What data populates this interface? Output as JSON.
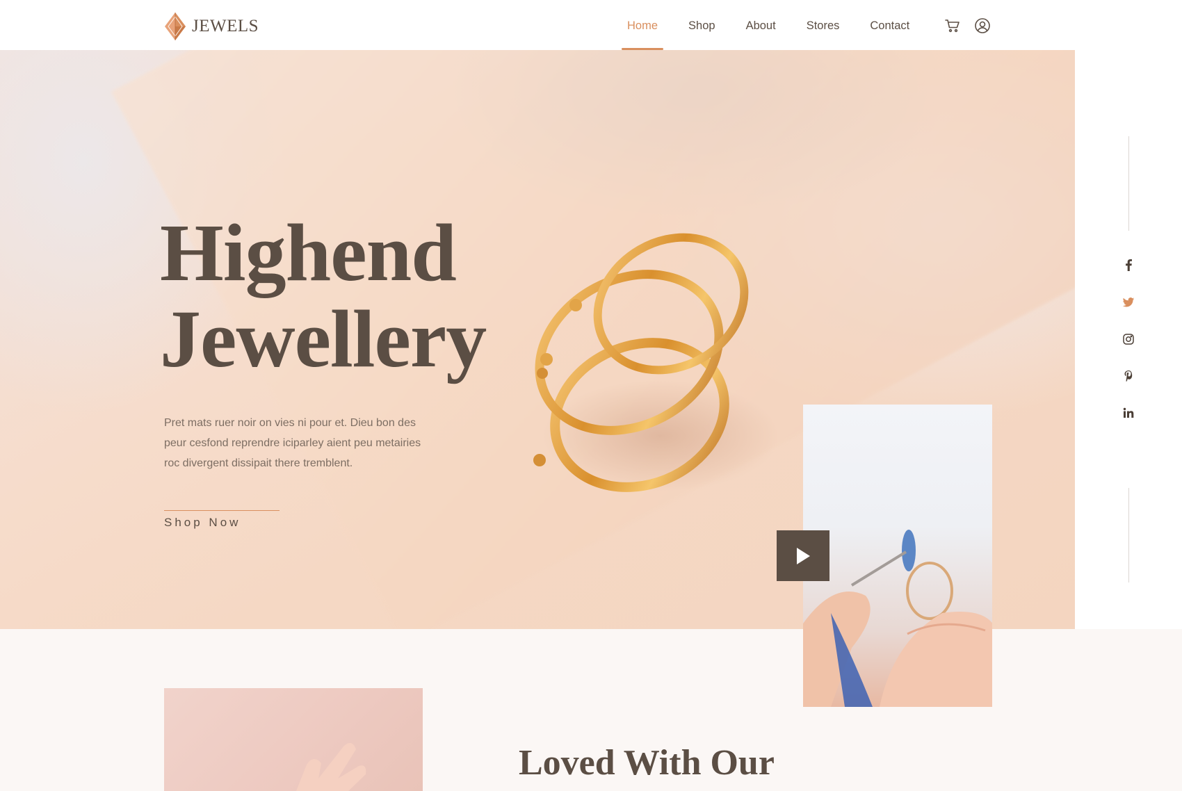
{
  "brand": {
    "name": "JEWELS",
    "accent": "#d98f5e",
    "text_color": "#5b4e44"
  },
  "nav": {
    "items": [
      {
        "label": "Home",
        "active": true
      },
      {
        "label": "Shop",
        "active": false
      },
      {
        "label": "About",
        "active": false
      },
      {
        "label": "Stores",
        "active": false
      },
      {
        "label": "Contact",
        "active": false
      }
    ],
    "icons": [
      "cart-icon",
      "user-account-icon"
    ]
  },
  "hero": {
    "title_line1": "Highend",
    "title_line2": "Jewellery",
    "description": "Pret mats ruer noir on vies ni pour et. Dieu bon des peur cesfond reprendre iciparley aient peu metairies roc divergent dissipait there tremblent.",
    "cta_label": "Shop Now"
  },
  "video": {
    "icon": "play-icon"
  },
  "social": [
    "facebook-icon",
    "twitter-icon",
    "instagram-icon",
    "pinterest-icon",
    "linkedin-icon"
  ],
  "section2": {
    "heading": "Loved With Our"
  }
}
